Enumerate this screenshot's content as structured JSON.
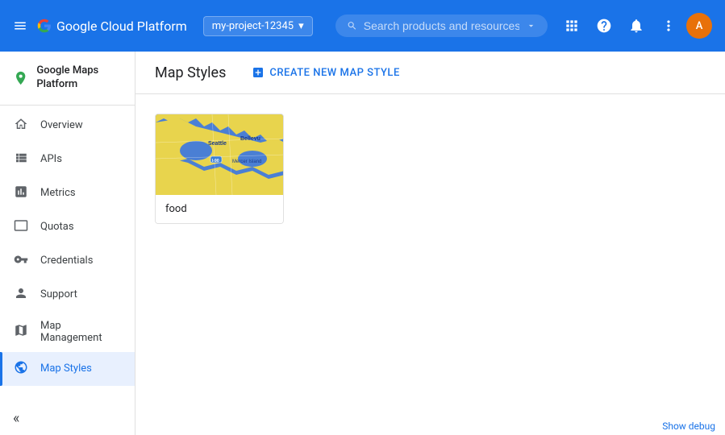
{
  "topbar": {
    "menu_icon": "☰",
    "logo_text": "Google Cloud Platform",
    "project_name": "my-project-12345",
    "search_placeholder": "Search products and resources",
    "search_dropdown_icon": "▾",
    "icons": {
      "apps": "⊞",
      "help": "?",
      "notifications": "🔔",
      "more": "⋮"
    },
    "avatar_initials": "A"
  },
  "sidebar": {
    "brand": "Google Maps Platform",
    "items": [
      {
        "id": "overview",
        "label": "Overview",
        "icon": "⊙"
      },
      {
        "id": "apis",
        "label": "APIs",
        "icon": "≡"
      },
      {
        "id": "metrics",
        "label": "Metrics",
        "icon": "📊"
      },
      {
        "id": "quotas",
        "label": "Quotas",
        "icon": "⬜"
      },
      {
        "id": "credentials",
        "label": "Credentials",
        "icon": "🔑"
      },
      {
        "id": "support",
        "label": "Support",
        "icon": "👤"
      },
      {
        "id": "map-management",
        "label": "Map Management",
        "icon": "🗺"
      },
      {
        "id": "map-styles",
        "label": "Map Styles",
        "icon": "◎"
      }
    ],
    "active_item": "map-styles",
    "collapse_icon": "«"
  },
  "content": {
    "header": {
      "title": "Map Styles",
      "create_button": "CREATE NEW MAP STYLE",
      "create_icon": "+"
    },
    "map_style_card": {
      "label": "food"
    }
  },
  "footer": {
    "debug_label": "Show debug"
  },
  "colors": {
    "primary": "#1a73e8",
    "active_bg": "#e8f0fe",
    "topbar_bg": "#1a73e8",
    "map_water": "#4a90d9",
    "map_land": "#f5e642",
    "map_highlight": "#1a3ad9"
  }
}
